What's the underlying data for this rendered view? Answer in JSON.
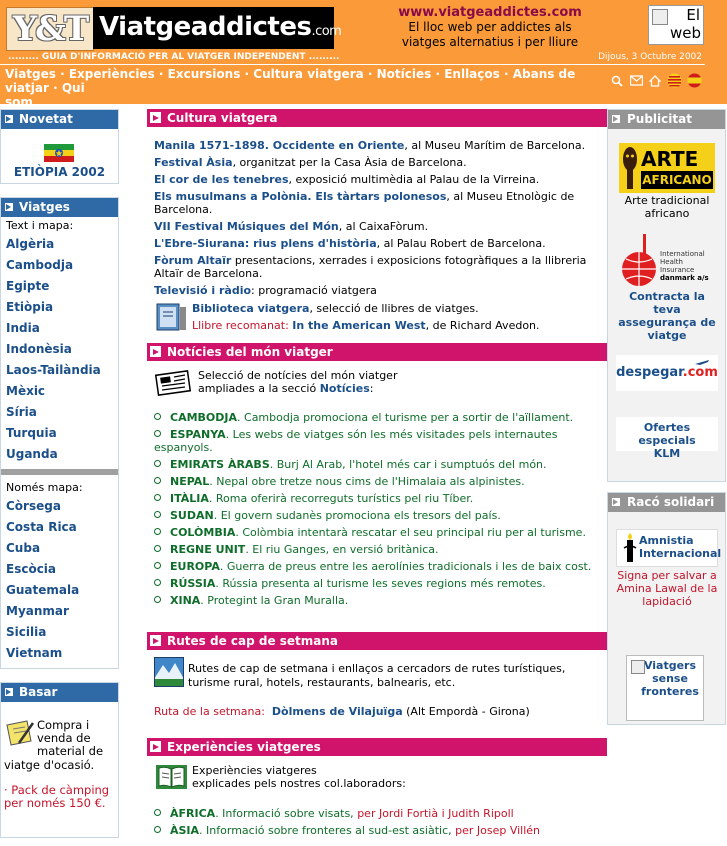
{
  "header": {
    "logo_left": "Y&T",
    "logo_name": "Viatgeaddictes",
    "logo_com": ".com",
    "url": "www.viatgeaddictes.com",
    "tagline_1": "El lloc web per addictes als",
    "tagline_2": "viatges alternatius i per lliure",
    "broken_image_alt": "El web",
    "guide": "......... GUIA D'INFORMACIÓ PER AL VIATGER INDEPENDENT .........",
    "date": "Dijous, 3 Octubre 2002"
  },
  "nav": [
    "Viatges",
    "Experiències",
    "Excursions",
    "Cultura viatgera",
    "Notícies",
    "Enllaços",
    "Abans de viatjar",
    "Qui",
    "som"
  ],
  "sidebar": {
    "novetat": {
      "title": "Novetat",
      "label": "ETIÒPIA 2002"
    },
    "viatges": {
      "title": "Viatges",
      "text_map_label": "Text i mapa:",
      "text_map": [
        "Algèria",
        "Cambodja",
        "Egipte",
        "Etiòpia",
        "India",
        "Indonèsia",
        "Laos-Tailàndia",
        "Mèxic",
        "Síria",
        "Turquia",
        "Uganda"
      ],
      "map_only_label": "Només mapa:",
      "map_only": [
        "Còrsega",
        "Costa Rica",
        "Cuba",
        "Escòcia",
        "Guatemala",
        "Myanmar",
        "Sicilia",
        "Vietnam"
      ]
    },
    "basar": {
      "title": "Basar",
      "text": "Compra i venda de material de viatge d'ocasió.",
      "line1": "Compra i",
      "line2": "venda de",
      "line3": "material de",
      "line4": "viatge d'ocasió.",
      "offer": "· Pack de càmping per només 150 €."
    }
  },
  "cultura": {
    "title": "Cultura viatgera",
    "items": [
      {
        "link": "Manila 1571-1898. Occidente en Oriente",
        "rest": ", al Museu Marítim de Barcelona."
      },
      {
        "link": "Festival Àsia",
        "rest": ", organitzat per la Casa Àsia de Barcelona."
      },
      {
        "link": "El cor de les tenebres",
        "rest": ", exposició multimèdia al Palau de la Virreina."
      },
      {
        "link": "Els musulmans a Polònia. Els tàrtars polonesos",
        "rest": ", al Museu Etnològic de Barcelona."
      },
      {
        "link": "VII Festival Músiques del Món",
        "rest": ", al CaixaFòrum."
      },
      {
        "link": "L'Ebre-Siurana: rius plens d'història",
        "rest": ", al Palau Robert de Barcelona."
      },
      {
        "link": "Fòrum Altaïr",
        "rest": " presentacions, xerrades i exposicions fotogràfiques a la llibreria Altaïr de Barcelona."
      },
      {
        "link": "Televisió i ràdio",
        "rest": ": programació viatgera"
      }
    ],
    "biblioteca_link": "Biblioteca viatgera",
    "biblioteca_rest": ", selecció de llibres de viatges.",
    "llibre_label": "Llibre recomanat:",
    "llibre_title": "In the American West",
    "llibre_author": ", de Richard Avedon."
  },
  "noticies": {
    "title": "Notícies del món viatger",
    "intro_1": "Selecció de notícies del món viatger",
    "intro_2": "ampliades a la secció ",
    "intro_link": "Notícies",
    "intro_colon": ":",
    "items": [
      {
        "country": "CAMBODJA",
        "text": ". Cambodja promociona el turisme per a sortir de l'aïllament."
      },
      {
        "country": "ESPANYA",
        "text": ". Les webs de viatges són les més visitades pels internautes espanyols."
      },
      {
        "country": "EMIRATS ÀRABS",
        "text": ". Burj Al Arab, l'hotel més car i sumptuós del món."
      },
      {
        "country": "NEPAL",
        "text": ". Nepal obre tretze nous cims de l'Himalaia als alpinistes."
      },
      {
        "country": "ITÀLIA",
        "text": ". Roma oferirà recorreguts turístics pel riu Tíber."
      },
      {
        "country": "SUDAN",
        "text": ". El govern sudanès promociona els tresors del país."
      },
      {
        "country": "COLÒMBIA",
        "text": ". Colòmbia intentarà rescatar el seu principal riu per al turisme."
      },
      {
        "country": "REGNE UNIT",
        "text": ". El riu Ganges, en versió britànica."
      },
      {
        "country": "EUROPA",
        "text": ". Guerra de preus entre les aerolínies tradicionals i les de baix cost."
      },
      {
        "country": "RÚSSIA",
        "text": ". Rússia presenta al turisme les seves regions més remotes."
      },
      {
        "country": "XINA",
        "text": ". Protegint la Gran Muralla."
      }
    ]
  },
  "rutes": {
    "title": "Rutes de cap de setmana",
    "intro_1": "Rutes de cap de setmana i enllaços a cercadors de rutes turístiques,",
    "intro_2": "turisme rural, hotels, restaurants, balnearis, etc.",
    "ruta_label": "Ruta de la setmana:",
    "ruta_link": "Dòlmens de Vilajuïga",
    "ruta_rest": " (Alt Empordà - Girona)"
  },
  "experiencies": {
    "title": "Experiències viatgeres",
    "intro_1": "Experiències viatgeres",
    "intro_2": "explicades pels nostres col.laboradors:",
    "items": [
      {
        "region": "ÀFRICA",
        "text": ". Informació sobre visats, ",
        "author": "per Jordi Fortià i Judith Ripoll"
      },
      {
        "region": "ÀSIA",
        "text": ". Informació sobre fronteres al sud-est asiàtic, ",
        "author": "per Josep Villén"
      }
    ]
  },
  "publicitat": {
    "title": "Publicitat",
    "arte_1": "ARTE",
    "arte_2": "AFRICANO",
    "arte_caption": "Arte tradicional africano",
    "ihi_1": "International",
    "ihi_2": "Health",
    "ihi_3": "Insurance",
    "ihi_4": "danmark a/s",
    "ihi_caption": "Contracta la teva assegurança de viatge",
    "despegar": "despegar",
    "despegar_com": ".com",
    "klm": "Ofertes especials KLM"
  },
  "raco": {
    "title": "Racó solidari",
    "amnistia_1": "Amnistia",
    "amnistia_2": "Internacional",
    "amnistia_caption": "Signa per salvar a Amina Lawal de la lapidació",
    "viatgers": "Viatgers sense fronteres"
  },
  "colors": {
    "header": "#fb9a38",
    "magenta": "#d0136b",
    "blue": "#2f6aa6",
    "grey": "#959595",
    "link": "#1b4f8a",
    "green": "#0f6d2a",
    "red": "#c4142a"
  }
}
